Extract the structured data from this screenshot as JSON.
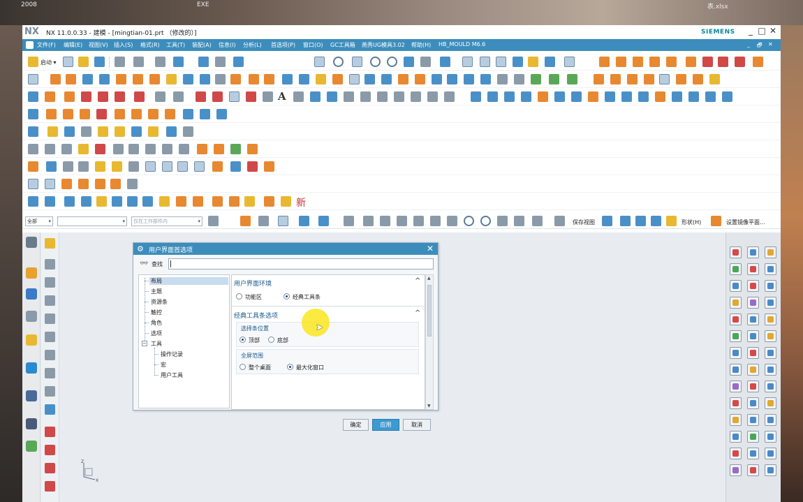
{
  "desktop": {
    "labels": [
      "2008",
      "EXE",
      "表.xlsx"
    ]
  },
  "window": {
    "logo": "NX",
    "title": "NX 11.0.0.33 - 建模 - [mingtian-01.prt （修改的）]",
    "brand": "SIEMENS",
    "controls": [
      "_",
      "□",
      "✕"
    ],
    "inner_controls": [
      "_",
      "🗗",
      "✕"
    ]
  },
  "menu": {
    "items": [
      "文件(F)",
      "编辑(E)",
      "视图(V)",
      "插入(S)",
      "格式(R)",
      "工具(T)",
      "装配(A)",
      "信息(I)",
      "分析(L)",
      "首选项(P)",
      "窗口(O)",
      "GC工具箱",
      "燕秀UG模具3.02",
      "帮助(H)",
      "HB_MOULD M6.6"
    ]
  },
  "toolbar": {
    "start_label": "启动 ▾",
    "glyph_text": "A",
    "red_glyph": "新",
    "save_view": "保存视图",
    "shape": "形状(H)",
    "set_mirror": "设置镜像平面..."
  },
  "filter": {
    "type_filter": "全部",
    "selection_scope": "",
    "scope_placeholder": "仅在工作部件内"
  },
  "dialog": {
    "title": "用户界面首选项",
    "find_label": "查找",
    "find_value": "",
    "tree": [
      "布局",
      "主题",
      "资源条",
      "触控",
      "角色",
      "选项",
      "工具",
      "操作记录",
      "宏",
      "用户工具"
    ],
    "sections": {
      "env_title": "用户界面环境",
      "env_options": [
        "功能区",
        "经典工具条"
      ],
      "env_selected": 1,
      "classic_title": "经典工具条选项",
      "bar_pos_label": "选择条位置",
      "bar_pos_options": [
        "顶部",
        "底部"
      ],
      "bar_pos_selected": 0,
      "fullscreen_label": "全屏范围",
      "fullscreen_options": [
        "整个桌面",
        "最大化窗口"
      ],
      "fullscreen_selected": 1
    },
    "buttons": {
      "ok": "确定",
      "apply": "应用",
      "cancel": "取消"
    }
  },
  "axis": {
    "z_label": "Z",
    "x_label": "X"
  }
}
